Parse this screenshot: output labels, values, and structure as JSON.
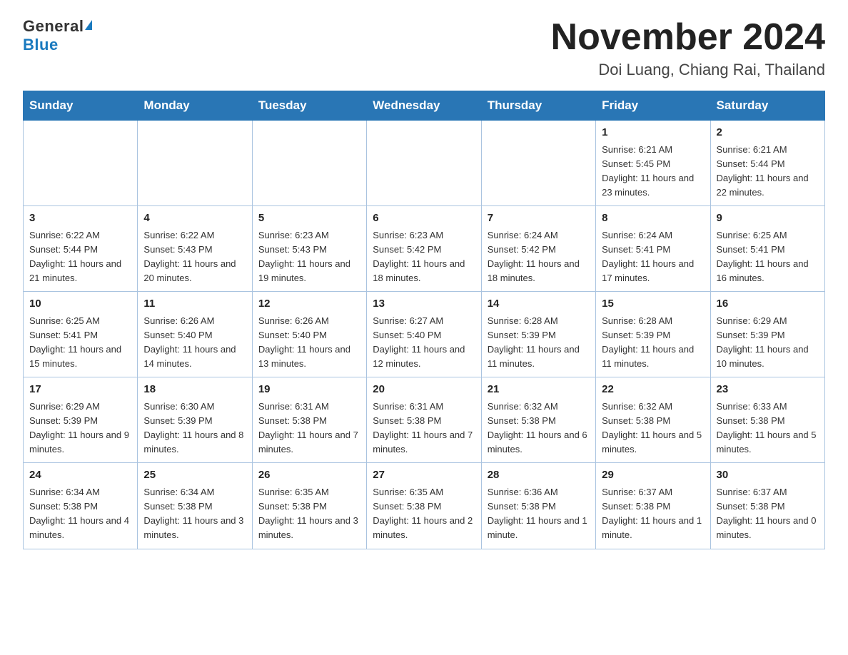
{
  "header": {
    "logo_general": "General",
    "logo_blue": "Blue",
    "month_title": "November 2024",
    "location": "Doi Luang, Chiang Rai, Thailand"
  },
  "days_of_week": [
    "Sunday",
    "Monday",
    "Tuesday",
    "Wednesday",
    "Thursday",
    "Friday",
    "Saturday"
  ],
  "weeks": [
    [
      {
        "day": "",
        "info": ""
      },
      {
        "day": "",
        "info": ""
      },
      {
        "day": "",
        "info": ""
      },
      {
        "day": "",
        "info": ""
      },
      {
        "day": "",
        "info": ""
      },
      {
        "day": "1",
        "info": "Sunrise: 6:21 AM\nSunset: 5:45 PM\nDaylight: 11 hours and 23 minutes."
      },
      {
        "day": "2",
        "info": "Sunrise: 6:21 AM\nSunset: 5:44 PM\nDaylight: 11 hours and 22 minutes."
      }
    ],
    [
      {
        "day": "3",
        "info": "Sunrise: 6:22 AM\nSunset: 5:44 PM\nDaylight: 11 hours and 21 minutes."
      },
      {
        "day": "4",
        "info": "Sunrise: 6:22 AM\nSunset: 5:43 PM\nDaylight: 11 hours and 20 minutes."
      },
      {
        "day": "5",
        "info": "Sunrise: 6:23 AM\nSunset: 5:43 PM\nDaylight: 11 hours and 19 minutes."
      },
      {
        "day": "6",
        "info": "Sunrise: 6:23 AM\nSunset: 5:42 PM\nDaylight: 11 hours and 18 minutes."
      },
      {
        "day": "7",
        "info": "Sunrise: 6:24 AM\nSunset: 5:42 PM\nDaylight: 11 hours and 18 minutes."
      },
      {
        "day": "8",
        "info": "Sunrise: 6:24 AM\nSunset: 5:41 PM\nDaylight: 11 hours and 17 minutes."
      },
      {
        "day": "9",
        "info": "Sunrise: 6:25 AM\nSunset: 5:41 PM\nDaylight: 11 hours and 16 minutes."
      }
    ],
    [
      {
        "day": "10",
        "info": "Sunrise: 6:25 AM\nSunset: 5:41 PM\nDaylight: 11 hours and 15 minutes."
      },
      {
        "day": "11",
        "info": "Sunrise: 6:26 AM\nSunset: 5:40 PM\nDaylight: 11 hours and 14 minutes."
      },
      {
        "day": "12",
        "info": "Sunrise: 6:26 AM\nSunset: 5:40 PM\nDaylight: 11 hours and 13 minutes."
      },
      {
        "day": "13",
        "info": "Sunrise: 6:27 AM\nSunset: 5:40 PM\nDaylight: 11 hours and 12 minutes."
      },
      {
        "day": "14",
        "info": "Sunrise: 6:28 AM\nSunset: 5:39 PM\nDaylight: 11 hours and 11 minutes."
      },
      {
        "day": "15",
        "info": "Sunrise: 6:28 AM\nSunset: 5:39 PM\nDaylight: 11 hours and 11 minutes."
      },
      {
        "day": "16",
        "info": "Sunrise: 6:29 AM\nSunset: 5:39 PM\nDaylight: 11 hours and 10 minutes."
      }
    ],
    [
      {
        "day": "17",
        "info": "Sunrise: 6:29 AM\nSunset: 5:39 PM\nDaylight: 11 hours and 9 minutes."
      },
      {
        "day": "18",
        "info": "Sunrise: 6:30 AM\nSunset: 5:39 PM\nDaylight: 11 hours and 8 minutes."
      },
      {
        "day": "19",
        "info": "Sunrise: 6:31 AM\nSunset: 5:38 PM\nDaylight: 11 hours and 7 minutes."
      },
      {
        "day": "20",
        "info": "Sunrise: 6:31 AM\nSunset: 5:38 PM\nDaylight: 11 hours and 7 minutes."
      },
      {
        "day": "21",
        "info": "Sunrise: 6:32 AM\nSunset: 5:38 PM\nDaylight: 11 hours and 6 minutes."
      },
      {
        "day": "22",
        "info": "Sunrise: 6:32 AM\nSunset: 5:38 PM\nDaylight: 11 hours and 5 minutes."
      },
      {
        "day": "23",
        "info": "Sunrise: 6:33 AM\nSunset: 5:38 PM\nDaylight: 11 hours and 5 minutes."
      }
    ],
    [
      {
        "day": "24",
        "info": "Sunrise: 6:34 AM\nSunset: 5:38 PM\nDaylight: 11 hours and 4 minutes."
      },
      {
        "day": "25",
        "info": "Sunrise: 6:34 AM\nSunset: 5:38 PM\nDaylight: 11 hours and 3 minutes."
      },
      {
        "day": "26",
        "info": "Sunrise: 6:35 AM\nSunset: 5:38 PM\nDaylight: 11 hours and 3 minutes."
      },
      {
        "day": "27",
        "info": "Sunrise: 6:35 AM\nSunset: 5:38 PM\nDaylight: 11 hours and 2 minutes."
      },
      {
        "day": "28",
        "info": "Sunrise: 6:36 AM\nSunset: 5:38 PM\nDaylight: 11 hours and 1 minute."
      },
      {
        "day": "29",
        "info": "Sunrise: 6:37 AM\nSunset: 5:38 PM\nDaylight: 11 hours and 1 minute."
      },
      {
        "day": "30",
        "info": "Sunrise: 6:37 AM\nSunset: 5:38 PM\nDaylight: 11 hours and 0 minutes."
      }
    ]
  ]
}
